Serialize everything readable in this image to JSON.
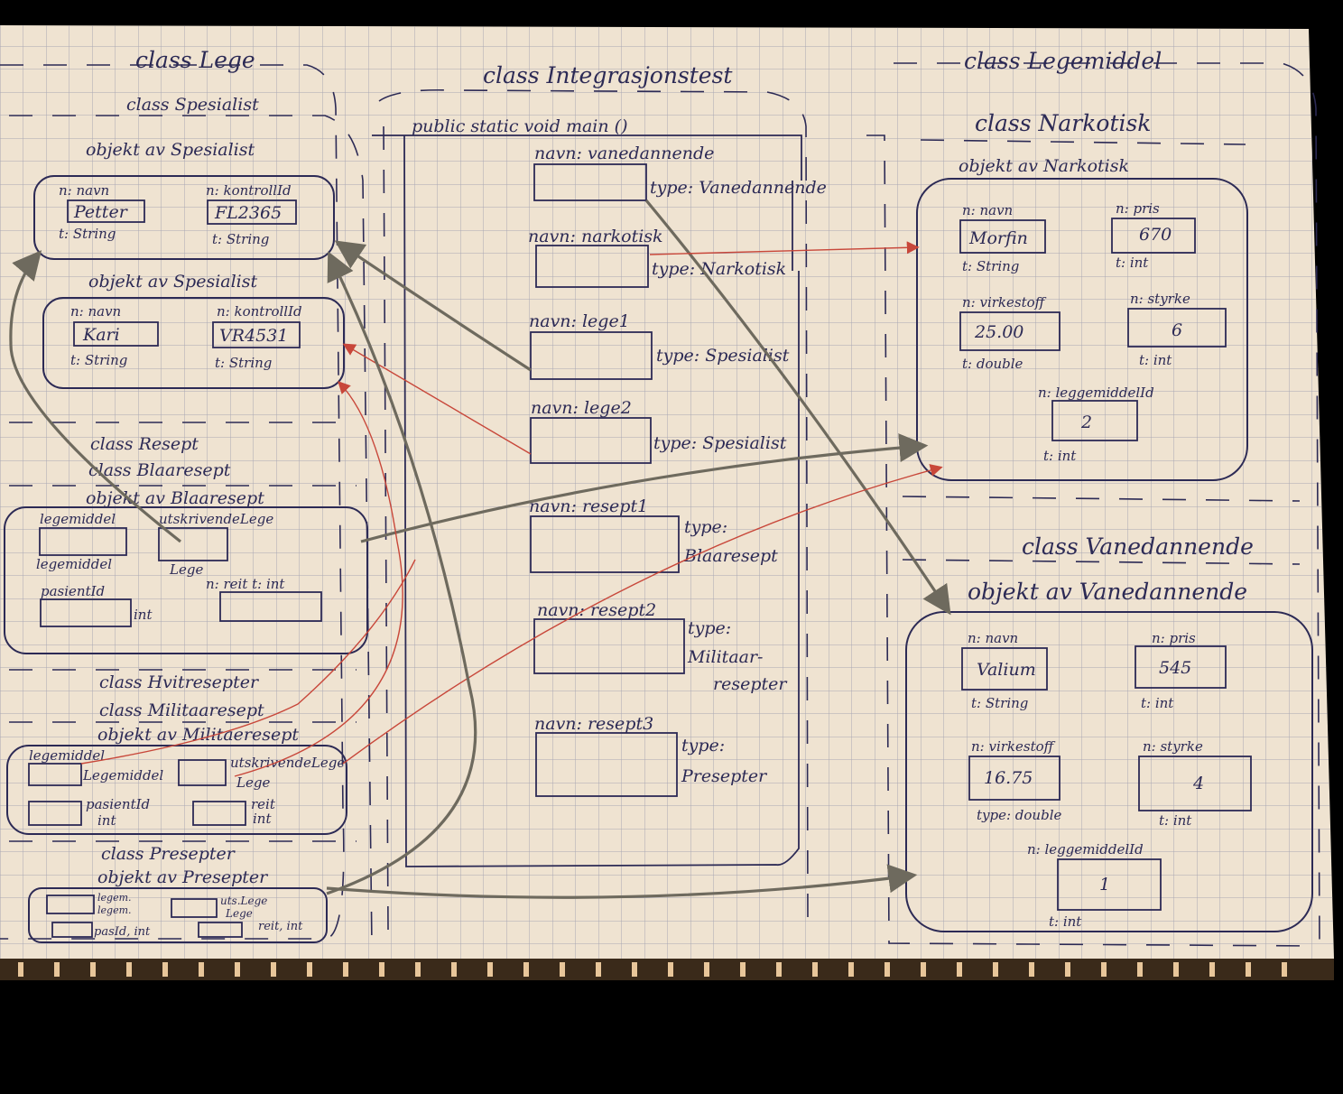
{
  "colors": {
    "paper": "#efe3d1",
    "grid": "#a8a7b4",
    "ink": "#2c2a55",
    "grey_arrow": "#6e6a5e",
    "red_arrow": "#c8473a",
    "background": "#000000"
  },
  "lege": {
    "title_lege": "class Lege",
    "title_spesialist": "class Spesialist",
    "obj1": {
      "title": "objekt av Spesialist",
      "navn_label": "n: navn",
      "navn_value": "Petter",
      "navn_type": "t: String",
      "kontroll_label": "n: kontrollId",
      "kontroll_value": "FL2365",
      "kontroll_type": "t: String"
    },
    "obj2": {
      "title": "objekt av Spesialist",
      "navn_label": "n: navn",
      "navn_value": "Kari",
      "navn_type": "t: String",
      "kontroll_label": "n: kontrollId",
      "kontroll_value": "VR4531",
      "kontroll_type": "t: String"
    }
  },
  "resept": {
    "title_resept": "class Resept",
    "title_blaa": "class Blaaresept",
    "blaa_obj_title": "objekt av Blaaresept",
    "blaa_legemiddel_label": "legemiddel",
    "blaa_legemiddel_type": "legemiddel",
    "blaa_lege_label": "utskrivendeLege",
    "blaa_lege_type": "Lege",
    "blaa_pasient_label": "pasientId",
    "blaa_pasient_type": "int",
    "blaa_reit_label": "n: reit  t: int",
    "title_hvit": "class Hvitresepter",
    "title_mil": "class Militaaresept",
    "mil_obj_title": "objekt av Militaeresept",
    "mil_legemiddel_label": "legemiddel",
    "mil_legemiddel_type": "Legemiddel",
    "mil_lege_label": "utskrivendeLege",
    "mil_lege_type": "Lege",
    "mil_pasient_label": "pasientId",
    "mil_pasient_type": "int",
    "mil_reit_label": "reit",
    "mil_reit_type": "int",
    "title_p": "class Presepter",
    "p_obj_title": "objekt av Presepter",
    "p_legem_label": "legem.",
    "p_legem_type": "legem.",
    "p_lege_label": "uts.Lege",
    "p_lege_type": "Lege",
    "p_pasid": "pasId, int",
    "p_reit": "reit, int"
  },
  "integrasjon": {
    "title": "class Integrasjonstest",
    "main": "public static void main ()",
    "vars": [
      {
        "name": "navn: vanedannende",
        "type": "type: Vanedannende"
      },
      {
        "name": "navn: narkotisk",
        "type": "type: Narkotisk"
      },
      {
        "name": "navn: lege1",
        "type": "type: Spesialist"
      },
      {
        "name": "navn: lege2",
        "type": "type: Spesialist"
      },
      {
        "name": "navn: resept1",
        "type1": "type:",
        "type2": "Blaaresept"
      },
      {
        "name": "navn: resept2",
        "type1": "type:",
        "type2": "Militaar-",
        "type3": "resepter"
      },
      {
        "name": "navn: resept3",
        "type1": "type:",
        "type2": "Presepter"
      }
    ]
  },
  "legemiddel": {
    "title": "class Legemiddel",
    "title_narkotisk": "class Narkotisk",
    "nark_obj_title": "objekt av Narkotisk",
    "nark": {
      "navn_label": "n: navn",
      "navn_value": "Morfin",
      "navn_type": "t: String",
      "pris_label": "n: pris",
      "pris_value": "670",
      "pris_type": "t: int",
      "virke_label": "n: virkestoff",
      "virke_value": "25.00",
      "virke_type": "t: double",
      "styrke_label": "n: styrke",
      "styrke_value": "6",
      "styrke_type": "t: int",
      "id_label": "n: leggemiddelId",
      "id_value": "2",
      "id_type": "t: int"
    },
    "title_vanedannende": "class Vanedannende",
    "vane_obj_title": "objekt av Vanedannende",
    "vane": {
      "navn_label": "n: navn",
      "navn_value": "Valium",
      "navn_type": "t: String",
      "pris_label": "n: pris",
      "pris_value": "545",
      "pris_type": "t: int",
      "virke_label": "n: virkestoff",
      "virke_value": "16.75",
      "virke_type": "type: double",
      "styrke_label": "n: styrke",
      "styrke_value": "4",
      "styrke_type": "t: int",
      "id_label": "n: leggemiddelId",
      "id_value": "1",
      "id_type": "t: int"
    }
  }
}
